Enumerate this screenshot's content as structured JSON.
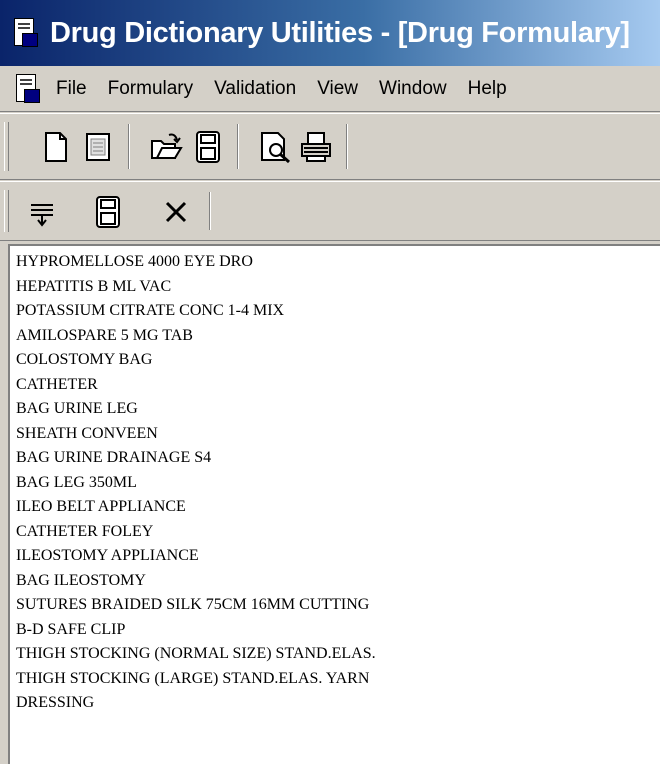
{
  "window": {
    "title": "Drug Dictionary Utilities - [Drug Formulary]"
  },
  "menubar": {
    "items": [
      "File",
      "Formulary",
      "Validation",
      "View",
      "Window",
      "Help"
    ]
  },
  "toolbar1": {
    "buttons": [
      "new-document-icon",
      "form-icon",
      "open-folder-icon",
      "save-disk-icon",
      "print-preview-icon",
      "printer-icon"
    ]
  },
  "toolbar2": {
    "buttons": [
      "filter-icon",
      "save-disk-icon",
      "close-x-icon"
    ]
  },
  "drug_list": {
    "items": [
      "HYPROMELLOSE 4000 EYE DRO",
      "HEPATITIS B ML VAC",
      "POTASSIUM CITRATE CONC 1-4 MIX",
      "AMILOSPARE 5 MG TAB",
      "COLOSTOMY BAG",
      "CATHETER",
      "BAG URINE LEG",
      "SHEATH CONVEEN",
      "BAG URINE DRAINAGE S4",
      "BAG LEG 350ML",
      "ILEO BELT APPLIANCE",
      "CATHETER FOLEY",
      "ILEOSTOMY APPLIANCE",
      "BAG ILEOSTOMY",
      "SUTURES BRAIDED SILK 75CM 16MM CUTTING",
      "B-D SAFE CLIP",
      "THIGH STOCKING (NORMAL SIZE) STAND.ELAS.",
      "THIGH STOCKING (LARGE) STAND.ELAS. YARN",
      "DRESSING"
    ]
  }
}
